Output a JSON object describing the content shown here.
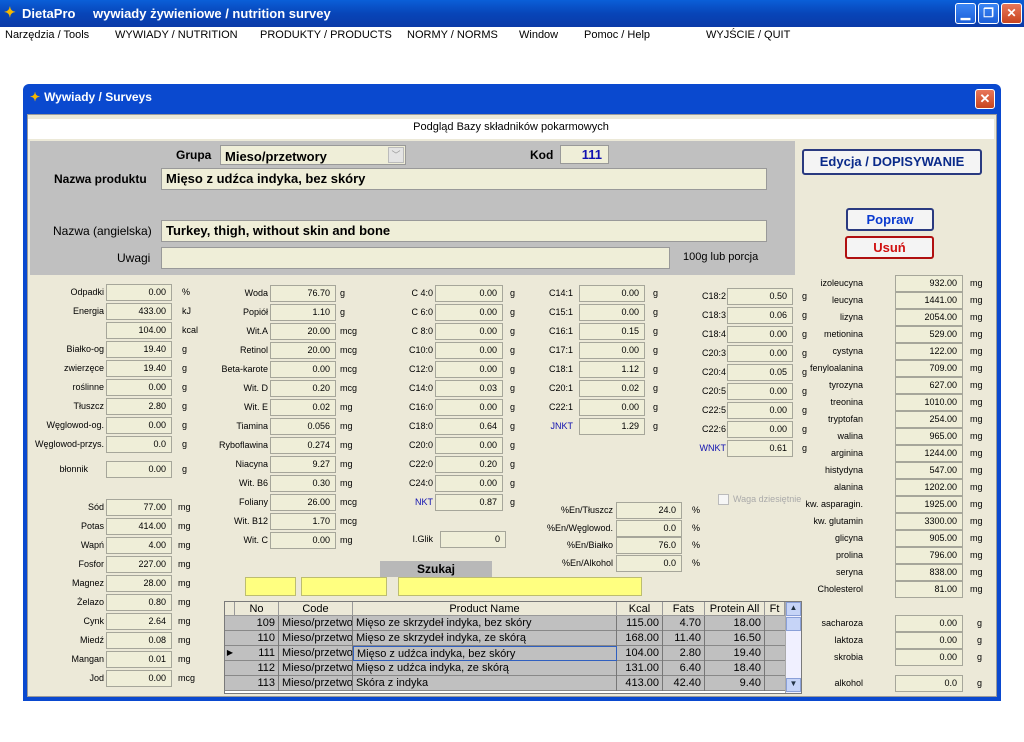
{
  "app": {
    "title": "DietaPro",
    "subtitle": "wywiady żywieniowe / nutrition survey"
  },
  "menu": [
    "Narzędzia / Tools",
    "WYWIADY / NUTRITION",
    "PRODUKTY / PRODUCTS",
    "NORMY / NORMS",
    "Window",
    "Pomoc / Help",
    "WYJŚCIE / QUIT"
  ],
  "dialog": {
    "title": "Wywiady / Surveys",
    "header": "Podgląd Bazy składników pokarmowych"
  },
  "form": {
    "grupa_label": "Grupa",
    "grupa_value": "Mieso/przetwory",
    "kod_label": "Kod",
    "kod_value": "111",
    "nazwa_label": "Nazwa produktu",
    "nazwa_value": "Mięso z udźca indyka, bez skóry",
    "nazwa_en_label": "Nazwa (angielska)",
    "nazwa_en_value": "Turkey, thigh, without skin and bone",
    "uwagi_label": "Uwagi",
    "uwagi_value": "",
    "porcja_label": "100g lub porcja"
  },
  "buttons": {
    "edit": "Edycja / DOPISYWANIE",
    "fix": "Popraw",
    "delete": "Usuń"
  },
  "col1": [
    {
      "l": "Odpadki",
      "v": "0.00",
      "u": "%"
    },
    {
      "l": "Energia",
      "v": "433.00",
      "u": "kJ"
    },
    {
      "l": "",
      "v": "104.00",
      "u": "kcal"
    },
    {
      "l": "Białko-og",
      "v": "19.40",
      "u": "g"
    },
    {
      "l": "zwierzęce",
      "v": "19.40",
      "u": "g"
    },
    {
      "l": "roślinne",
      "v": "0.00",
      "u": "g"
    },
    {
      "l": "Tłuszcz",
      "v": "2.80",
      "u": "g"
    },
    {
      "l": "Węglowod-og.",
      "v": "0.00",
      "u": "g"
    },
    {
      "l": "Węglowod-przys.",
      "v": "0.0",
      "u": "g"
    }
  ],
  "blonnik": {
    "l": "błonnik",
    "v": "0.00",
    "u": "g"
  },
  "col1b": [
    {
      "l": "Sód",
      "v": "77.00",
      "u": "mg"
    },
    {
      "l": "Potas",
      "v": "414.00",
      "u": "mg"
    },
    {
      "l": "Wapń",
      "v": "4.00",
      "u": "mg"
    },
    {
      "l": "Fosfor",
      "v": "227.00",
      "u": "mg"
    },
    {
      "l": "Magnez",
      "v": "28.00",
      "u": "mg"
    },
    {
      "l": "Żelazo",
      "v": "0.80",
      "u": "mg"
    },
    {
      "l": "Cynk",
      "v": "2.64",
      "u": "mg"
    },
    {
      "l": "Miedź",
      "v": "0.08",
      "u": "mg"
    },
    {
      "l": "Mangan",
      "v": "0.01",
      "u": "mg"
    },
    {
      "l": "Jod",
      "v": "0.00",
      "u": "mcg"
    }
  ],
  "col2": [
    {
      "l": "Woda",
      "v": "76.70",
      "u": "g"
    },
    {
      "l": "Popiół",
      "v": "1.10",
      "u": "g"
    },
    {
      "l": "Wit.A",
      "v": "20.00",
      "u": "mcg"
    },
    {
      "l": "Retinol",
      "v": "20.00",
      "u": "mcg"
    },
    {
      "l": "Beta-karote",
      "v": "0.00",
      "u": "mcg"
    },
    {
      "l": "Wit. D",
      "v": "0.20",
      "u": "mcg"
    },
    {
      "l": "Wit. E",
      "v": "0.02",
      "u": "mg"
    },
    {
      "l": "Tiamina",
      "v": "0.056",
      "u": "mg"
    },
    {
      "l": "Ryboflawina",
      "v": "0.274",
      "u": "mg"
    },
    {
      "l": "Niacyna",
      "v": "9.27",
      "u": "mg"
    },
    {
      "l": "Wit. B6",
      "v": "0.30",
      "u": "mg"
    },
    {
      "l": "Foliany",
      "v": "26.00",
      "u": "mcg"
    },
    {
      "l": "Wit. B12",
      "v": "1.70",
      "u": "mcg"
    },
    {
      "l": "Wit. C",
      "v": "0.00",
      "u": "mg"
    }
  ],
  "col3": [
    {
      "l": "C 4:0",
      "v": "0.00",
      "u": "g"
    },
    {
      "l": "C 6:0",
      "v": "0.00",
      "u": "g"
    },
    {
      "l": "C 8:0",
      "v": "0.00",
      "u": "g"
    },
    {
      "l": "C10:0",
      "v": "0.00",
      "u": "g"
    },
    {
      "l": "C12:0",
      "v": "0.00",
      "u": "g"
    },
    {
      "l": "C14:0",
      "v": "0.03",
      "u": "g"
    },
    {
      "l": "C16:0",
      "v": "0.00",
      "u": "g"
    },
    {
      "l": "C18:0",
      "v": "0.64",
      "u": "g"
    },
    {
      "l": "C20:0",
      "v": "0.00",
      "u": "g"
    },
    {
      "l": "C22:0",
      "v": "0.20",
      "u": "g"
    },
    {
      "l": "C24:0",
      "v": "0.00",
      "u": "g"
    },
    {
      "l": "NKT",
      "v": "0.87",
      "u": "g"
    }
  ],
  "iglik": {
    "l": "I.Glik",
    "v": "0"
  },
  "col4": [
    {
      "l": "C14:1",
      "v": "0.00",
      "u": "g"
    },
    {
      "l": "C15:1",
      "v": "0.00",
      "u": "g"
    },
    {
      "l": "C16:1",
      "v": "0.15",
      "u": "g"
    },
    {
      "l": "C17:1",
      "v": "0.00",
      "u": "g"
    },
    {
      "l": "C18:1",
      "v": "1.12",
      "u": "g"
    },
    {
      "l": "C20:1",
      "v": "0.02",
      "u": "g"
    },
    {
      "l": "C22:1",
      "v": "0.00",
      "u": "g"
    },
    {
      "l": "JNKT",
      "v": "1.29",
      "u": "g"
    }
  ],
  "col5": [
    {
      "l": "C18:2",
      "v": "0.50",
      "u": "g"
    },
    {
      "l": "C18:3",
      "v": "0.06",
      "u": "g"
    },
    {
      "l": "C18:4",
      "v": "0.00",
      "u": "g"
    },
    {
      "l": "C20:3",
      "v": "0.00",
      "u": "g"
    },
    {
      "l": "C20:4",
      "v": "0.05",
      "u": "g"
    },
    {
      "l": "C20:5",
      "v": "0.00",
      "u": "g"
    },
    {
      "l": "C22:5",
      "v": "0.00",
      "u": "g"
    },
    {
      "l": "C22:6",
      "v": "0.00",
      "u": "g"
    },
    {
      "l": "WNKT",
      "v": "0.61",
      "u": "g"
    }
  ],
  "energy": [
    {
      "l": "%En/Tłuszcz",
      "v": "24.0",
      "u": "%"
    },
    {
      "l": "%En/Węglowod.",
      "v": "0.0",
      "u": "%"
    },
    {
      "l": "%En/Białko",
      "v": "76.0",
      "u": "%"
    },
    {
      "l": "%En/Alkohol",
      "v": "0.0",
      "u": "%"
    }
  ],
  "waga_label": "Waga dziesiętnie",
  "amino": [
    {
      "l": "izoleucyna",
      "v": "932.00",
      "u": "mg"
    },
    {
      "l": "leucyna",
      "v": "1441.00",
      "u": "mg"
    },
    {
      "l": "lizyna",
      "v": "2054.00",
      "u": "mg"
    },
    {
      "l": "metionina",
      "v": "529.00",
      "u": "mg"
    },
    {
      "l": "cystyna",
      "v": "122.00",
      "u": "mg"
    },
    {
      "l": "fenyloalanina",
      "v": "709.00",
      "u": "mg"
    },
    {
      "l": "tyrozyna",
      "v": "627.00",
      "u": "mg"
    },
    {
      "l": "treonina",
      "v": "1010.00",
      "u": "mg"
    },
    {
      "l": "tryptofan",
      "v": "254.00",
      "u": "mg"
    },
    {
      "l": "walina",
      "v": "965.00",
      "u": "mg"
    },
    {
      "l": "arginina",
      "v": "1244.00",
      "u": "mg"
    },
    {
      "l": "histydyna",
      "v": "547.00",
      "u": "mg"
    },
    {
      "l": "alanina",
      "v": "1202.00",
      "u": "mg"
    },
    {
      "l": "kw. asparagin.",
      "v": "1925.00",
      "u": "mg"
    },
    {
      "l": "kw. glutamin",
      "v": "3300.00",
      "u": "mg"
    },
    {
      "l": "glicyna",
      "v": "905.00",
      "u": "mg"
    },
    {
      "l": "prolina",
      "v": "796.00",
      "u": "mg"
    },
    {
      "l": "seryna",
      "v": "838.00",
      "u": "mg"
    },
    {
      "l": "Cholesterol",
      "v": "81.00",
      "u": "mg"
    }
  ],
  "sugars": [
    {
      "l": "sacharoza",
      "v": "0.00",
      "u": "g"
    },
    {
      "l": "laktoza",
      "v": "0.00",
      "u": "g"
    },
    {
      "l": "skrobia",
      "v": "0.00",
      "u": "g"
    }
  ],
  "alkohol": {
    "l": "alkohol",
    "v": "0.0",
    "u": "g"
  },
  "search": {
    "label": "Szukaj"
  },
  "table": {
    "headers": [
      "No",
      "Code",
      "Product Name",
      "Kcal",
      "Fats",
      "Protein All",
      "Ft"
    ],
    "rows": [
      [
        "109",
        "Mieso/przetwo",
        "Mięso ze skrzydeł indyka, bez skóry",
        "115.00",
        "4.70",
        "18.00"
      ],
      [
        "110",
        "Mieso/przetwo",
        "Mięso ze skrzydeł indyka, ze skórą",
        "168.00",
        "11.40",
        "16.50"
      ],
      [
        "111",
        "Mieso/przetwo",
        "Mięso z udźca indyka, bez skóry",
        "104.00",
        "2.80",
        "19.40"
      ],
      [
        "112",
        "Mieso/przetwo",
        "Mięso z udźca indyka, ze skórą",
        "131.00",
        "6.40",
        "18.40"
      ],
      [
        "113",
        "Mieso/przetwo",
        "Skóra z indyka",
        "413.00",
        "42.40",
        "9.40"
      ]
    ]
  }
}
